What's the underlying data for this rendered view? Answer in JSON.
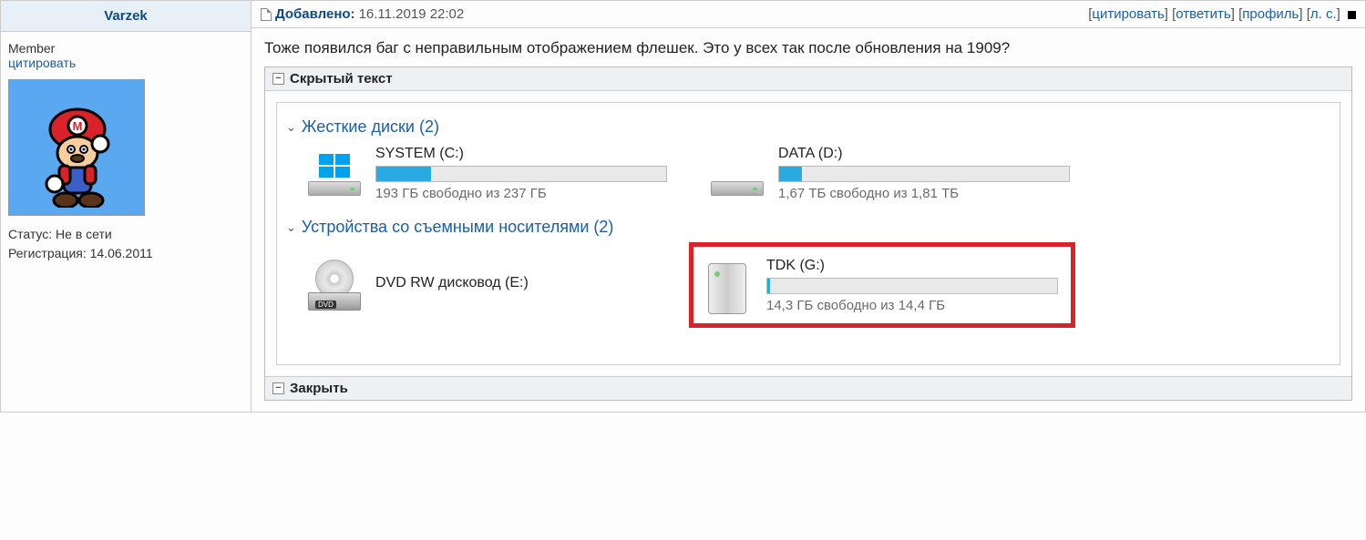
{
  "user": {
    "name": "Varzek",
    "role": "Member",
    "quote_link": "цитировать",
    "status_label": "Статус:",
    "status_value": "Не в сети",
    "reg_label": "Регистрация:",
    "reg_value": "14.06.2011"
  },
  "header": {
    "added_label": "Добавлено:",
    "added_time": "16.11.2019 22:02",
    "actions": {
      "quote": "цитировать",
      "reply": "ответить",
      "profile": "профиль",
      "pm": "л. с."
    }
  },
  "body": {
    "text": "Тоже появился баг с неправильным отображением флешек. Это у всех так после обновления на 1909?"
  },
  "spoiler": {
    "header": "Скрытый текст",
    "footer": "Закрыть",
    "groups": {
      "hdd": {
        "title": "Жесткие диски (2)",
        "drives": [
          {
            "name": "SYSTEM (C:)",
            "stats": "193 ГБ свободно из 237 ГБ",
            "fill_pct": 19
          },
          {
            "name": "DATA (D:)",
            "stats": "1,67 ТБ свободно из 1,81 ТБ",
            "fill_pct": 8
          }
        ]
      },
      "removable": {
        "title": "Устройства со съемными носителями (2)",
        "dvd": {
          "name": "DVD RW дисковод (E:)"
        },
        "usb": {
          "name": "TDK (G:)",
          "stats": "14,3 ГБ свободно из 14,4 ГБ",
          "fill_pct": 1
        }
      }
    }
  }
}
